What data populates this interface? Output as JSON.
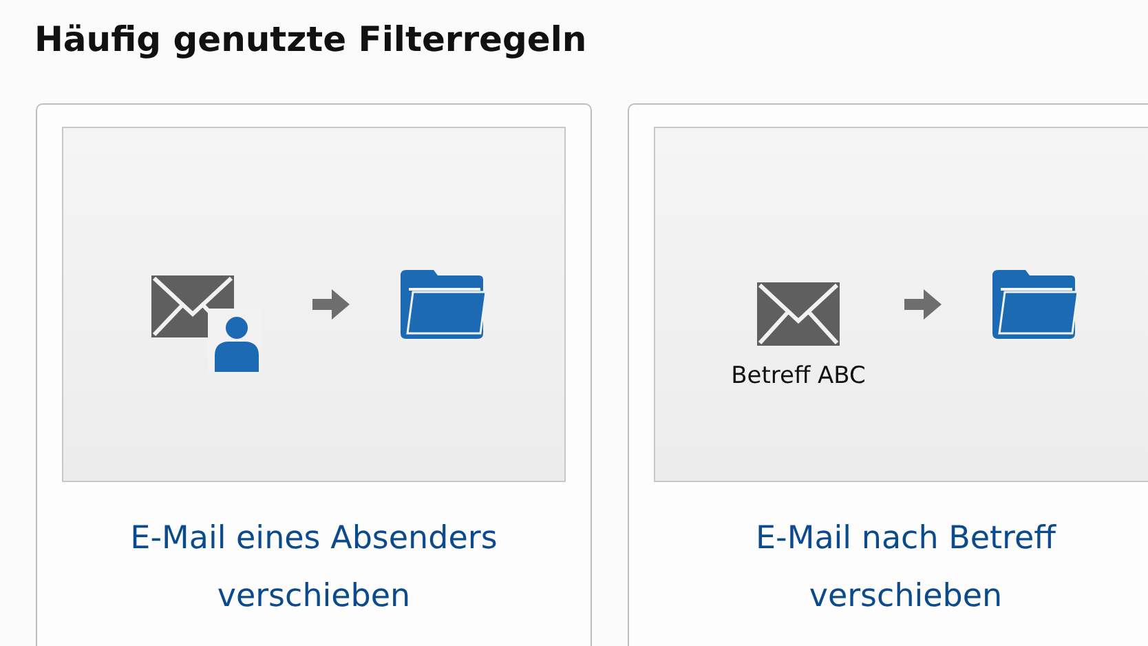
{
  "heading": "Häufig genutzte Filterregeln",
  "rules": [
    {
      "kind": "sender",
      "caption": "E-Mail eines Absenders verschieben"
    },
    {
      "kind": "subject",
      "subject_label": "Betreff ABC",
      "caption": "E-Mail nach Betreff verschieben"
    }
  ]
}
